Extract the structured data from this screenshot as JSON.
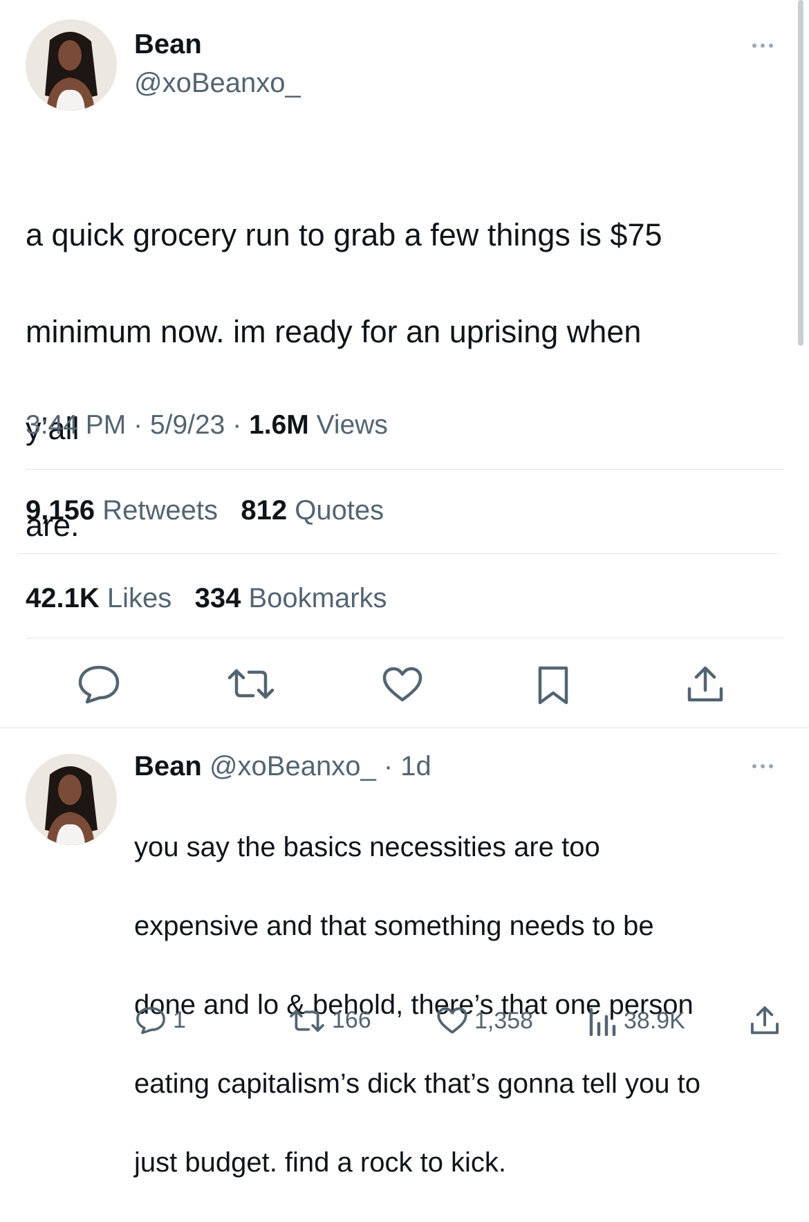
{
  "tweet": {
    "author_name": "Bean",
    "author_handle": "@xoBeanxo_",
    "text_lines": [
      "a quick grocery run to grab a few things is $75",
      "minimum now. im ready for an uprising when",
      "y’all",
      "are."
    ],
    "time": "3:44 PM",
    "date": "5/9/23",
    "separator": "·",
    "views_count": "1.6M",
    "views_label": "Views",
    "retweets_count": "9,156",
    "retweets_label": "Retweets",
    "quotes_count": "812",
    "quotes_label": "Quotes",
    "likes_count": "42.1K",
    "likes_label": "Likes",
    "bookmarks_count": "334",
    "bookmarks_label": "Bookmarks"
  },
  "action_bar": {
    "icons": [
      "reply-icon",
      "retweet-icon",
      "like-icon",
      "bookmark-icon",
      "share-icon"
    ]
  },
  "reply": {
    "author_name": "Bean",
    "author_handle": "@xoBeanxo_",
    "time_ago": "· 1d",
    "text_lines": [
      "you say the basics necessities are too",
      "expensive and that something needs to be",
      "done and lo & behold, there’s that one person",
      "eating capitalism’s dick that’s gonna tell you to",
      "just budget. find a rock to kick."
    ],
    "replies": "1",
    "retweets": "166",
    "likes": "1,358",
    "views": "38.9K"
  },
  "colors": {
    "text": "#0f1419",
    "muted": "#536471",
    "divider": "#e2e6ea",
    "icon": "#536471"
  }
}
